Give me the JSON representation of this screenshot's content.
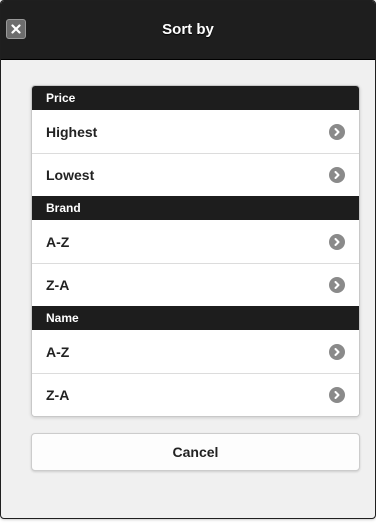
{
  "header": {
    "title": "Sort by",
    "close_icon": "close-icon"
  },
  "sections": [
    {
      "title": "Price",
      "items": [
        {
          "label": "Highest"
        },
        {
          "label": "Lowest"
        }
      ]
    },
    {
      "title": "Brand",
      "items": [
        {
          "label": "A-Z"
        },
        {
          "label": "Z-A"
        }
      ]
    },
    {
      "title": "Name",
      "items": [
        {
          "label": "A-Z"
        },
        {
          "label": "Z-A"
        }
      ]
    }
  ],
  "cancel_label": "Cancel",
  "colors": {
    "header_bg": "#1e1e1e",
    "divider_bg": "#1d1d1d",
    "item_bg": "#ffffff",
    "arrow_bg": "#8a8a8a",
    "dialog_bg": "#f0f0f0"
  }
}
